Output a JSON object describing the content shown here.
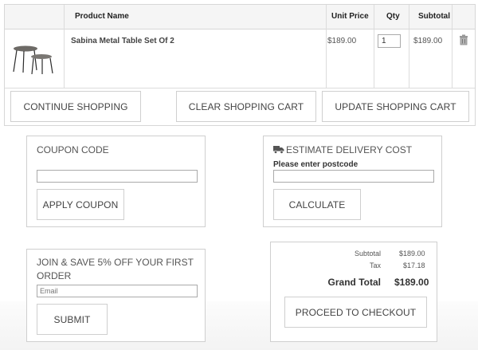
{
  "cart": {
    "headers": {
      "product": "Product Name",
      "unit_price": "Unit Price",
      "qty": "Qty",
      "subtotal": "Subtotal"
    },
    "items": [
      {
        "name": "Sabina Metal Table Set Of 2",
        "unit_price": "$189.00",
        "qty": "1",
        "subtotal": "$189.00",
        "image": "nesting-tables-image",
        "remove_icon": "trash-icon"
      }
    ],
    "actions": {
      "continue": "Continue Shopping",
      "clear": "Clear Shopping Cart",
      "update": "Update Shopping Cart"
    }
  },
  "coupon": {
    "title": "Coupon Code",
    "input_value": "",
    "button": "Apply Coupon"
  },
  "delivery": {
    "title": "Estimate Delivery Cost",
    "icon": "truck-icon",
    "label": "Please enter postcode",
    "input_value": "",
    "button": "Calculate"
  },
  "newsletter": {
    "title": "Join & Save 5% Off Your First Order",
    "placeholder": "Email",
    "button": "Submit"
  },
  "totals": {
    "subtotal_label": "Subtotal",
    "subtotal": "$189.00",
    "tax_label": "Tax",
    "tax": "$17.18",
    "grand_label": "Grand Total",
    "grand": "$189.00",
    "checkout": "Proceed to Checkout"
  }
}
